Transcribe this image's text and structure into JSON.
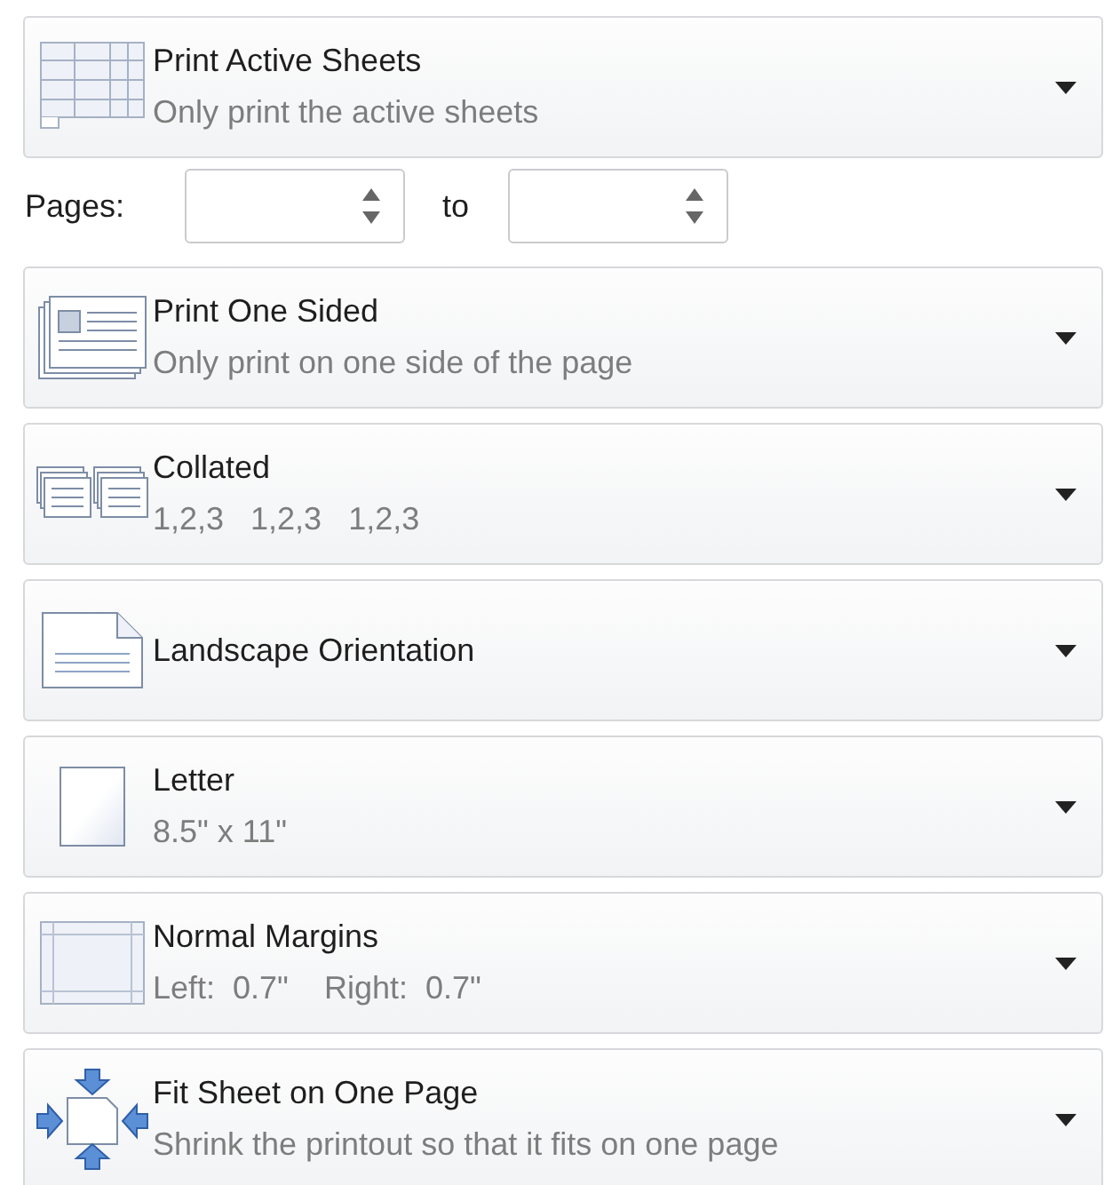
{
  "print_what": {
    "kind": "sheets",
    "title": "Print Active Sheets",
    "subtitle": "Only print the active sheets"
  },
  "pages": {
    "label": "Pages:",
    "separator": "to"
  },
  "settings": [
    {
      "kind": "one-sided",
      "title": "Print One Sided",
      "subtitle": "Only print on one side of the page"
    },
    {
      "kind": "collated",
      "title": "Collated",
      "subtitle": "1,2,3   1,2,3   1,2,3"
    },
    {
      "kind": "landscape",
      "title": "Landscape Orientation"
    },
    {
      "kind": "letter",
      "title": "Letter",
      "subtitle": "8.5\" x 11\""
    },
    {
      "kind": "margins",
      "title": "Normal Margins",
      "subtitle": "Left:  0.7\"    Right:  0.7\""
    },
    {
      "kind": "fit",
      "title": "Fit Sheet on One Page",
      "subtitle": "Shrink the printout so that it fits on one page"
    }
  ]
}
